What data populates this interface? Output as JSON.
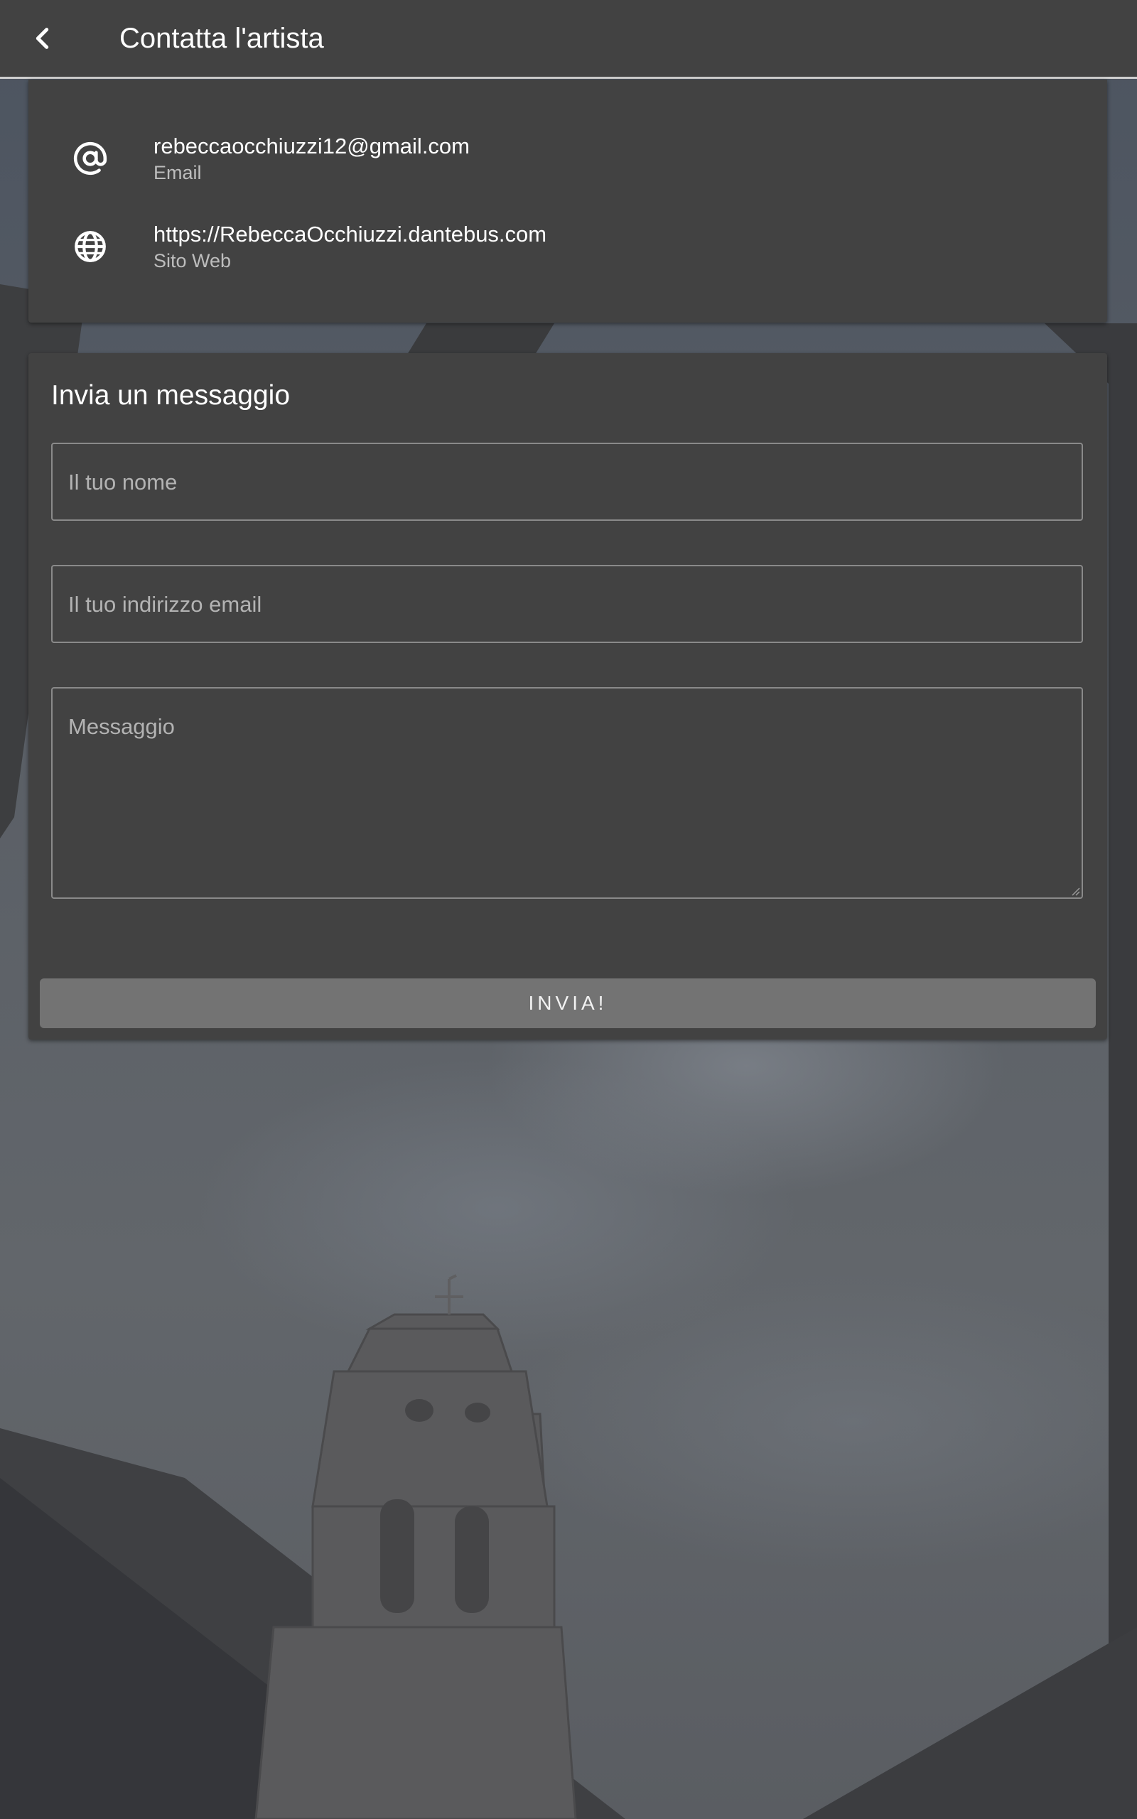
{
  "appbar": {
    "title": "Contatta l'artista",
    "back_icon": "chevron-left-icon"
  },
  "contact": {
    "items": [
      {
        "icon": "at-sign-icon",
        "value": "rebeccaocchiuzzi12@gmail.com",
        "label": "Email"
      },
      {
        "icon": "globe-icon",
        "value": "https://RebeccaOcchiuzzi.dantebus.com",
        "label": "Sito Web"
      }
    ]
  },
  "form": {
    "title": "Invia un messaggio",
    "name_placeholder": "Il tuo nome",
    "email_placeholder": "Il tuo indirizzo email",
    "message_placeholder": "Messaggio",
    "submit_label": "INVIA!"
  },
  "colors": {
    "surface": "#424242",
    "button": "#737373",
    "secondary_text": "#bdbdbd",
    "field_border": "#8a8a8a"
  }
}
